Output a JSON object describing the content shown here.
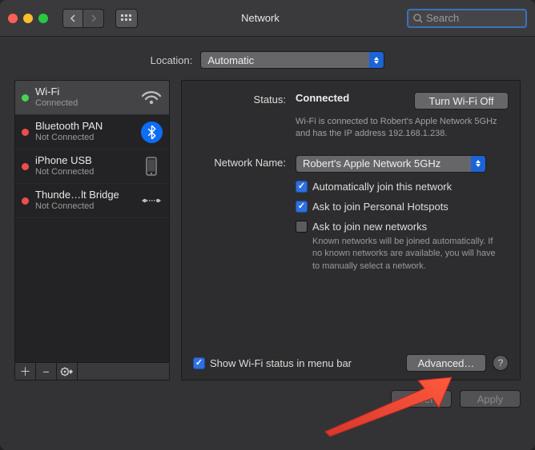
{
  "window": {
    "title": "Network",
    "search_placeholder": "Search"
  },
  "location": {
    "label": "Location:",
    "value": "Automatic"
  },
  "sidebar": {
    "items": [
      {
        "name": "Wi-Fi",
        "status": "Connected"
      },
      {
        "name": "Bluetooth PAN",
        "status": "Not Connected"
      },
      {
        "name": "iPhone USB",
        "status": "Not Connected"
      },
      {
        "name": "Thunde…lt Bridge",
        "status": "Not Connected"
      }
    ]
  },
  "main": {
    "status_label": "Status:",
    "status_value": "Connected",
    "wifi_off_btn": "Turn Wi-Fi Off",
    "status_info": "Wi-Fi is connected to Robert's Apple Network 5GHz and has the IP address 192.168.1.238.",
    "name_label": "Network Name:",
    "name_value": "Robert's Apple Network 5GHz",
    "chk_auto_join": "Automatically join this network",
    "chk_hotspot": "Ask to join Personal Hotspots",
    "chk_new": "Ask to join new networks",
    "new_hint": "Known networks will be joined automatically. If no known networks are available, you will have to manually select a network.",
    "chk_menubar": "Show Wi-Fi status in menu bar",
    "advanced_btn": "Advanced…"
  },
  "footer": {
    "revert": "Revert",
    "apply": "Apply"
  }
}
